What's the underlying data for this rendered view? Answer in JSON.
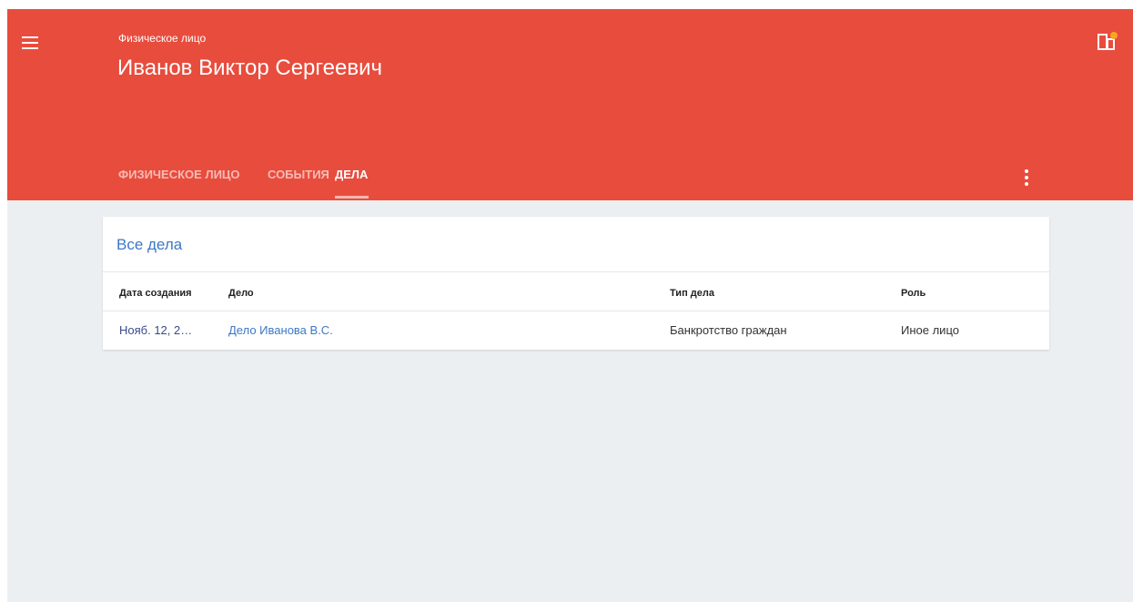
{
  "header": {
    "subtitle": "Физическое лицо",
    "title": "Иванов Виктор Сергеевич",
    "background_color": "#e84c3d",
    "menu_icon": "hamburger-menu-icon",
    "app_icon": "app-switch-icon",
    "app_icon_badge_color": "#f5a623"
  },
  "tabs": [
    {
      "label": "ФИЗИЧЕСКОЕ ЛИЦО",
      "active": false
    },
    {
      "label": "СОБЫТИЯ",
      "active": false
    },
    {
      "label": "ДЕЛА",
      "active": true
    }
  ],
  "more_icon": "more-vert-icon",
  "cases": {
    "title": "Все дела",
    "columns": [
      "Дата создания",
      "Дело",
      "Тип дела",
      "Роль"
    ],
    "rows": [
      {
        "date": "Нояб. 12, 2…",
        "case": "Дело Иванова В.С.",
        "type": "Банкротство граждан",
        "role": "Иное лицо"
      }
    ],
    "link_color": "#3d78c4"
  }
}
